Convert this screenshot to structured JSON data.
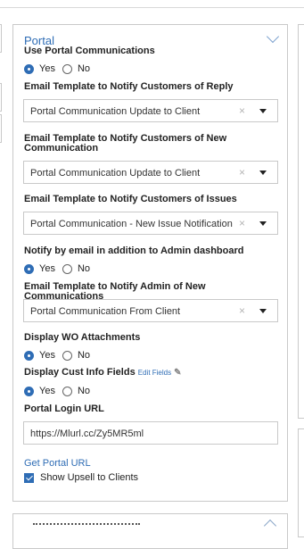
{
  "section": {
    "title": "Portal"
  },
  "fields": {
    "use_portal": {
      "label": "Use Portal Communications",
      "yes": "Yes",
      "no": "No",
      "selected": "Yes"
    },
    "reply_template": {
      "label": "Email Template to Notify Customers of Reply",
      "value": "Portal Communication Update to Client",
      "clear": "×"
    },
    "new_comm_template": {
      "label_line1": "Email Template to Notify Customers of New",
      "label_line2": "Communication",
      "value": "Portal Communication Update to Client",
      "clear": "×"
    },
    "issues_template": {
      "label": "Email Template to Notify Customers of Issues",
      "value": "Portal Communication - New Issue Notification",
      "clear": "×"
    },
    "notify_email": {
      "label": "Notify by email in addition to Admin dashboard",
      "yes": "Yes",
      "no": "No",
      "selected": "Yes"
    },
    "admin_template": {
      "label": "Email Template to Notify Admin of New Communications",
      "value": "Portal Communication From Client",
      "clear": "×"
    },
    "wo_attachments": {
      "label": "Display WO Attachments",
      "yes": "Yes",
      "no": "No",
      "selected": "Yes"
    },
    "cust_info": {
      "label": "Display Cust Info Fields",
      "edit_link": "Edit  Fields",
      "yes": "Yes",
      "no": "No",
      "selected": "Yes"
    },
    "portal_login_url": {
      "label": "Portal Login URL",
      "value": "https://Mlurl.cc/Zy5MR5ml"
    },
    "get_portal_url": "Get Portal URL",
    "show_upsell": {
      "label": "Show Upsell to Clients",
      "checked": true
    }
  },
  "colors": {
    "accent": "#2f6db5",
    "border": "#c9c9c9",
    "text": "#222222"
  },
  "icons": {
    "collapse": "chevron-down-icon",
    "clear": "clear-x-icon",
    "dropdown": "caret-down-icon",
    "edit": "pencil-icon"
  }
}
